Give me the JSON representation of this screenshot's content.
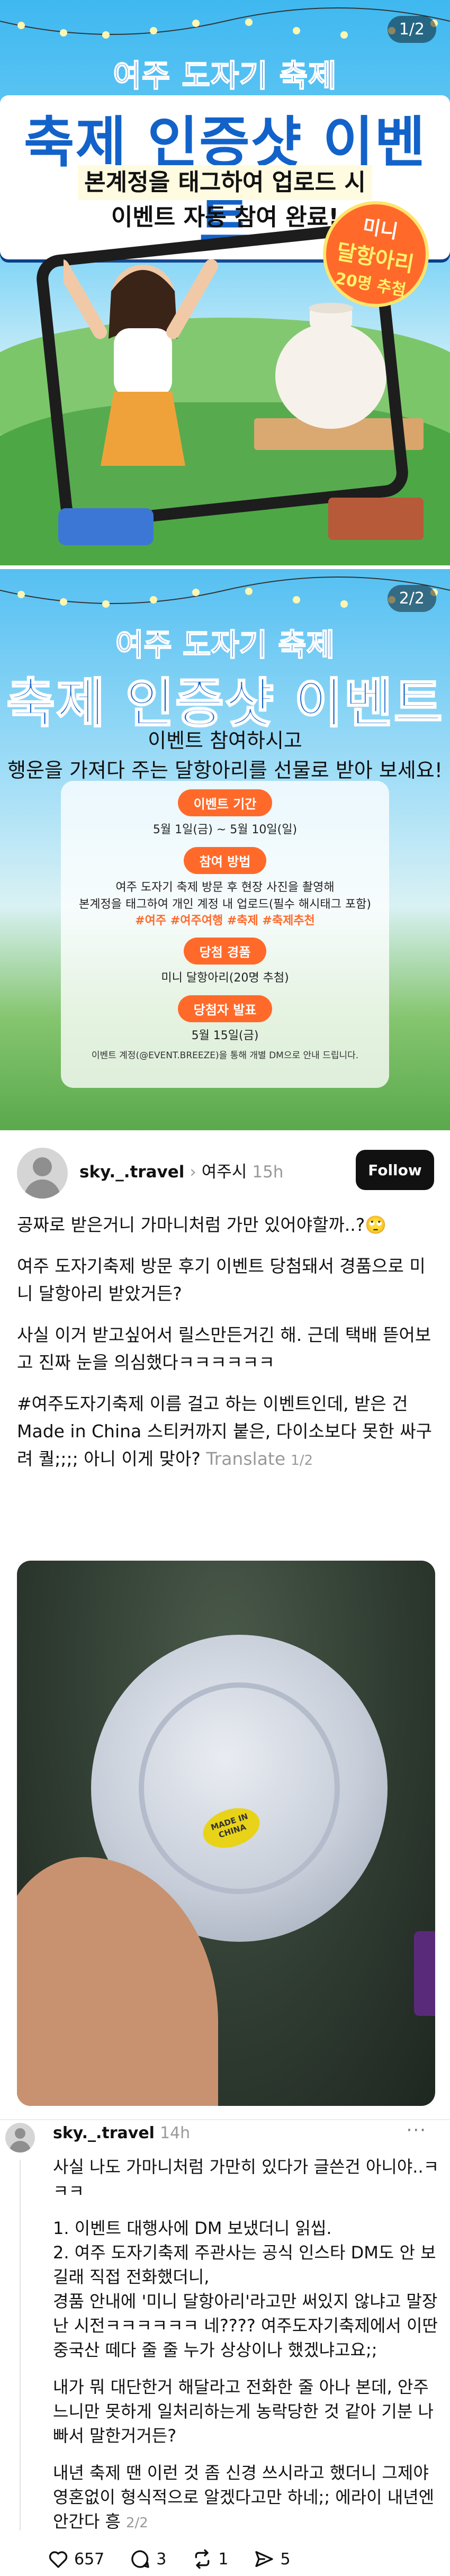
{
  "banner1": {
    "pager": "1/2",
    "subtitle": "여주 도자기 축제",
    "title": "축제 인증샷 이벤트",
    "desc_line1": "본계정을 태그하여 업로드 시",
    "desc_line2": "이벤트 자동 참여 완료!",
    "badge_line1": "미니",
    "badge_line2": "달항아리",
    "badge_line3": "20명 추첨"
  },
  "banner2": {
    "pager": "2/2",
    "subtitle": "여주 도자기 축제",
    "title": "축제 인증샷 이벤트",
    "desc_line1": "이벤트 참여하시고",
    "desc_line2": "행운을 가져다 주는 달항아리를 선물로 받아 보세요!",
    "sections": [
      {
        "label": "이벤트 기간",
        "text": "5월 1일(금) ~ 5월 10일(일)"
      },
      {
        "label": "참여 방법",
        "text": "여주 도자기 축제 방문 후 현장 사진을 촬영해",
        "text2": "본계정을 태그하여 개인 계정 내 업로드(필수 해시태그 포함)",
        "tags": "#여주 #여주여행 #축제 #축제추천"
      },
      {
        "label": "당첨 경품",
        "text": "미니 달항아리(20명 추첨)"
      },
      {
        "label": "당첨자 발표",
        "text": "5월 15일(금)",
        "note": "이벤트 계정(@EVENT.BREEZE)을 통해 개별 DM으로 안내 드립니다."
      }
    ]
  },
  "post": {
    "username": "sky._.travel",
    "location": "여주시",
    "time": "15h",
    "follow_label": "Follow",
    "paragraphs": [
      "공짜로 받은거니 가마니처럼 가만 있어야할까..?🙄",
      "여주 도자기축제 방문 후기 이벤트 당첨돼서 경품으로 미니 달항아리 받았거든?",
      "사실 이거 받고싶어서 릴스만든거긴 해. 근데 택배 뜯어보고 진짜 눈을 의심했다ㅋㅋㅋㅋㅋㅋ",
      "#여주도자기축제 이름 걸고 하는 이벤트인데, 받은 건 Made in China 스티커까지 붙은, 다이소보다 못한 싸구려 퀄;;;; 아니 이게 맞아?"
    ],
    "translate_label": "Translate",
    "page_count": "1/2",
    "sticker_text": "MADE IN CHINA"
  },
  "reply": {
    "username": "sky._.travel",
    "time": "14h",
    "more_label": "···",
    "paragraphs": [
      [
        "사실 나도 가마니처럼 가만히 있다가 글쓴건 아니야..ㅋㅋㅋ"
      ],
      [
        "1. 이벤트 대행사에 DM 보냈더니 읽씹.",
        "2. 여주 도자기축제 주관사는 공식 인스타 DM도 안 보길래 직접 전화했더니,",
        "경품 안내에 '미니 달항아리'라고만 써있지 않냐고 말장난 시전ㅋㅋㅋㅋㅋㅋ 네???? 여주도자기축제에서 이딴 중국산 떼다 줄 줄 누가 상상이나 했겠냐고요;;"
      ],
      [
        "내가 뭐 대단한거 해달라고 전화한 줄 아나 본데, 안주느니만 못하게 일처리하는게 농락당한 것 같아 기분 나빠서 말한거거든?"
      ],
      [
        "내년 축제 땐 이런 것 좀 신경 쓰시라고 했더니 그제야 영혼없이 형식적으로 알겠다고만 하네;; 에라이 내년엔 안간다 흥"
      ]
    ],
    "page_count": "2/2"
  },
  "actions": {
    "likes": "657",
    "comments": "3",
    "reposts": "1",
    "shares": "5"
  }
}
